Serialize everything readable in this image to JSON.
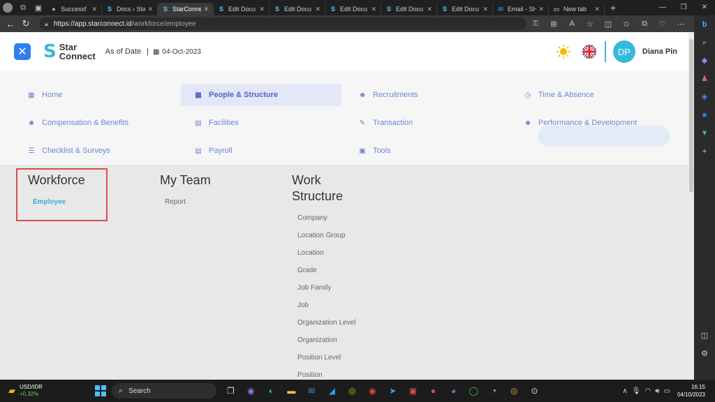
{
  "browser": {
    "tabs": [
      {
        "label": "Successf",
        "active": false
      },
      {
        "label": "Docs ‹ Star",
        "active": false
      },
      {
        "label": "StarConne",
        "active": true
      },
      {
        "label": "Edit Docu",
        "active": false
      },
      {
        "label": "Edit Docu",
        "active": false
      },
      {
        "label": "Edit Docu",
        "active": false
      },
      {
        "label": "Edit Docu",
        "active": false
      },
      {
        "label": "Edit Docu",
        "active": false
      },
      {
        "label": "Email - SH",
        "active": false
      },
      {
        "label": "New tab",
        "active": false
      }
    ],
    "url_host": "https://app.starconnect.id",
    "url_path": "/workforce/employee"
  },
  "header": {
    "logo_line1": "Star",
    "logo_line2": "Connect",
    "as_of_label": "As of Date",
    "as_of_sep": "|",
    "as_of_date": "04-Oct-2023",
    "avatar_initials": "DP",
    "user_name": "Diana Pin"
  },
  "menu": {
    "items": [
      {
        "label": "Home",
        "icon": "dashboard-icon",
        "active": false
      },
      {
        "label": "People & Structure",
        "icon": "calendar-icon",
        "active": true
      },
      {
        "label": "Recruitments",
        "icon": "user-add-icon",
        "active": false
      },
      {
        "label": "Time & Absence",
        "icon": "clock-calendar-icon",
        "active": false
      },
      {
        "label": "Compensation & Benefits",
        "icon": "user-money-icon",
        "active": false
      },
      {
        "label": "Facilities",
        "icon": "building-icon",
        "active": false
      },
      {
        "label": "Transaction",
        "icon": "edit-box-icon",
        "active": false
      },
      {
        "label": "Performance & Development",
        "icon": "user-gear-icon",
        "active": false
      },
      {
        "label": "Checklist & Surveys",
        "icon": "checklist-icon",
        "active": false
      },
      {
        "label": "Payroll",
        "icon": "payroll-icon",
        "active": false
      },
      {
        "label": "Tools",
        "icon": "tools-icon",
        "active": false
      }
    ]
  },
  "columns": {
    "workforce": {
      "title": "Workforce",
      "items": [
        "Employee"
      ]
    },
    "myteam": {
      "title": "My Team",
      "items": [
        "Report"
      ]
    },
    "structure": {
      "title_line1": "Work",
      "title_line2": "Structure",
      "items": [
        "Company",
        "Location Group",
        "Location",
        "Grade",
        "Job Family",
        "Job",
        "Organization Level",
        "Organization",
        "Position Level",
        "Position"
      ]
    }
  },
  "taskbar": {
    "ticker_name": "USD/IDR",
    "ticker_change": "+0,32%",
    "search_label": "Search",
    "time": "16:15",
    "date": "04/10/2023"
  },
  "colors": {
    "accent": "#3ab6d8",
    "menu_text": "#6b86d6",
    "highlight_box": "#e04a4a",
    "close_button": "#2f80ed"
  }
}
